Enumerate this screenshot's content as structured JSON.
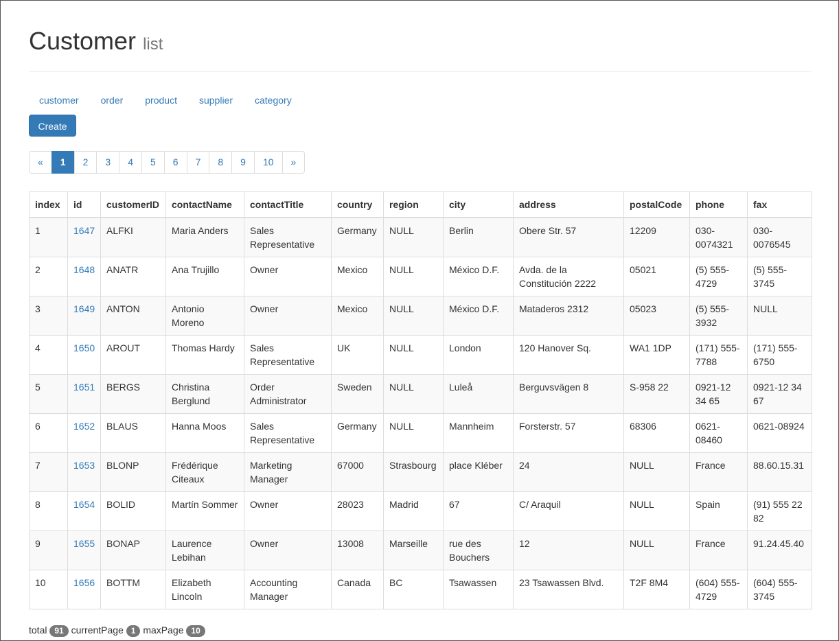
{
  "header": {
    "title": "Customer",
    "subtitle": "list"
  },
  "nav": [
    "customer",
    "order",
    "product",
    "supplier",
    "category"
  ],
  "toolbar": {
    "create_label": "Create"
  },
  "pagination": [
    "«",
    "1",
    "2",
    "3",
    "4",
    "5",
    "6",
    "7",
    "8",
    "9",
    "10",
    "»"
  ],
  "pagination_active": "1",
  "table": {
    "columns": [
      "index",
      "id",
      "customerID",
      "contactName",
      "contactTitle",
      "country",
      "region",
      "city",
      "address",
      "postalCode",
      "phone",
      "fax"
    ],
    "rows": [
      [
        "1",
        "1647",
        "ALFKI",
        "Maria Anders",
        "Sales Representative",
        "Germany",
        "NULL",
        "Berlin",
        "Obere Str. 57",
        "12209",
        "030-0074321",
        "030-0076545"
      ],
      [
        "2",
        "1648",
        "ANATR",
        "Ana Trujillo",
        "Owner",
        "Mexico",
        "NULL",
        "México D.F.",
        "Avda. de la Constitución 2222",
        "05021",
        "(5) 555-4729",
        "(5) 555-3745"
      ],
      [
        "3",
        "1649",
        "ANTON",
        "Antonio Moreno",
        "Owner",
        "Mexico",
        "NULL",
        "México D.F.",
        "Mataderos 2312",
        "05023",
        "(5) 555-3932",
        "NULL"
      ],
      [
        "4",
        "1650",
        "AROUT",
        "Thomas Hardy",
        "Sales Representative",
        "UK",
        "NULL",
        "London",
        "120 Hanover Sq.",
        "WA1 1DP",
        "(171) 555-7788",
        "(171) 555-6750"
      ],
      [
        "5",
        "1651",
        "BERGS",
        "Christina Berglund",
        "Order Administrator",
        "Sweden",
        "NULL",
        "Luleå",
        "Berguvsvägen 8",
        "S-958 22",
        "0921-12 34 65",
        "0921-12 34 67"
      ],
      [
        "6",
        "1652",
        "BLAUS",
        "Hanna Moos",
        "Sales Representative",
        "Germany",
        "NULL",
        "Mannheim",
        "Forsterstr. 57",
        "68306",
        "0621-08460",
        "0621-08924"
      ],
      [
        "7",
        "1653",
        "BLONP",
        "Frédérique Citeaux",
        "Marketing Manager",
        "67000",
        "Strasbourg",
        "place Kléber",
        "24",
        "NULL",
        "France",
        "88.60.15.31"
      ],
      [
        "8",
        "1654",
        "BOLID",
        "Martín Sommer",
        "Owner",
        "28023",
        "Madrid",
        "67",
        "C/ Araquil",
        "NULL",
        "Spain",
        "(91) 555 22 82"
      ],
      [
        "9",
        "1655",
        "BONAP",
        "Laurence Lebihan",
        "Owner",
        "13008",
        "Marseille",
        "rue des Bouchers",
        "12",
        "NULL",
        "France",
        "91.24.45.40"
      ],
      [
        "10",
        "1656",
        "BOTTM",
        "Elizabeth Lincoln",
        "Accounting Manager",
        "Canada",
        "BC",
        "Tsawassen",
        "23 Tsawassen Blvd.",
        "T2F 8M4",
        "(604) 555-4729",
        "(604) 555-3745"
      ]
    ]
  },
  "footer": {
    "total_label": "total",
    "total": "91",
    "current_label": "currentPage",
    "current": "1",
    "max_label": "maxPage",
    "max": "10"
  },
  "colors": {
    "link": "#337ab7",
    "primary": "#337ab7",
    "badge": "#777777"
  }
}
